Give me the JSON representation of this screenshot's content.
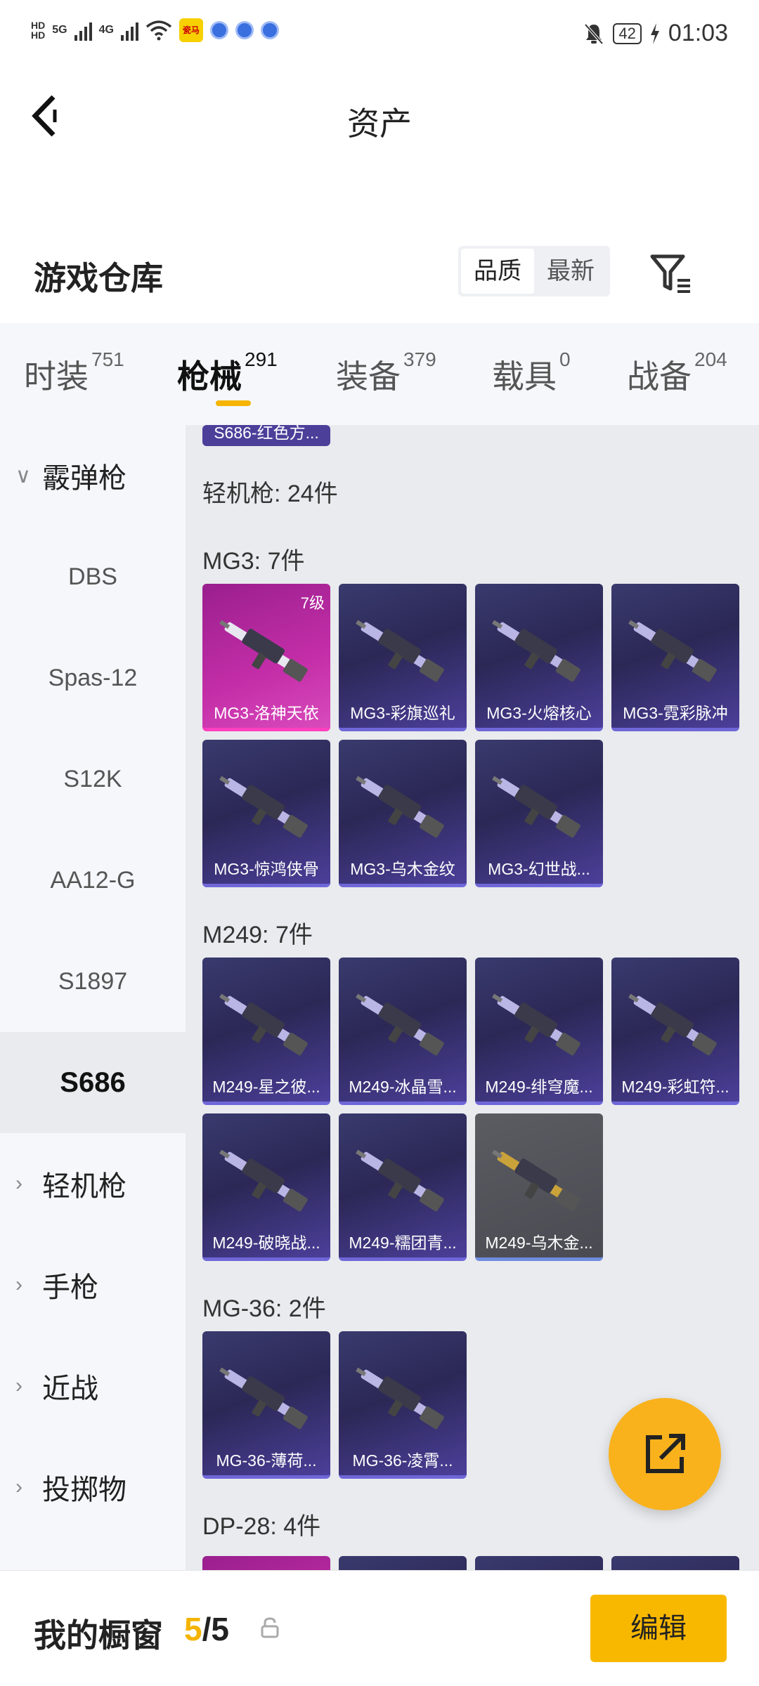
{
  "status_bar": {
    "hd1": "HD",
    "hd2": "HD",
    "net1": "5G",
    "net2": "4G",
    "app_icon_text": "瓷马",
    "battery": "42",
    "time": "01:03",
    "icons": [
      "signal-icon",
      "wifi-icon",
      "mute-bell-icon",
      "charging-icon"
    ]
  },
  "header": {
    "title": "资产"
  },
  "section": {
    "title": "游戏仓库",
    "sort_options": [
      "品质",
      "最新"
    ],
    "active_sort": "品质"
  },
  "tabs": [
    {
      "label": "时装",
      "count": "751"
    },
    {
      "label": "枪械",
      "count": "291"
    },
    {
      "label": "装备",
      "count": "379"
    },
    {
      "label": "载具",
      "count": "0"
    },
    {
      "label": "战备",
      "count": "204"
    }
  ],
  "active_tab": "枪械",
  "sidebar": {
    "items": [
      {
        "label": "霰弹枪",
        "type": "group-expanded"
      },
      {
        "label": "DBS",
        "type": "item"
      },
      {
        "label": "Spas-12",
        "type": "item"
      },
      {
        "label": "S12K",
        "type": "item"
      },
      {
        "label": "AA12-G",
        "type": "item"
      },
      {
        "label": "S1897",
        "type": "item"
      },
      {
        "label": "S686",
        "type": "selected"
      },
      {
        "label": "轻机枪",
        "type": "group"
      },
      {
        "label": "手枪",
        "type": "group"
      },
      {
        "label": "近战",
        "type": "group"
      },
      {
        "label": "投掷物",
        "type": "group"
      }
    ]
  },
  "content": {
    "partial_top_card": "S686-红色方...",
    "category_total": "轻机枪: 24件",
    "groups": [
      {
        "label": "MG3: 7件",
        "cards": [
          {
            "name": "MG3-洛神天依",
            "level": "7级",
            "rarity": "pink"
          },
          {
            "name": "MG3-彩旗巡礼",
            "level": "",
            "rarity": "purple"
          },
          {
            "name": "MG3-火熔核心",
            "level": "",
            "rarity": "purple"
          },
          {
            "name": "MG3-霓彩脉冲",
            "level": "",
            "rarity": "purple"
          },
          {
            "name": "MG3-惊鸿侠骨",
            "level": "",
            "rarity": "purple"
          },
          {
            "name": "MG3-乌木金纹",
            "level": "",
            "rarity": "purple"
          },
          {
            "name": "MG3-幻世战...",
            "level": "",
            "rarity": "purple"
          }
        ]
      },
      {
        "label": "M249: 7件",
        "cards": [
          {
            "name": "M249-星之彼...",
            "level": "",
            "rarity": "purple"
          },
          {
            "name": "M249-冰晶雪...",
            "level": "",
            "rarity": "purple"
          },
          {
            "name": "M249-绯穹魔...",
            "level": "",
            "rarity": "purple"
          },
          {
            "name": "M249-彩虹符...",
            "level": "",
            "rarity": "purple"
          },
          {
            "name": "M249-破晓战...",
            "level": "",
            "rarity": "purple"
          },
          {
            "name": "M249-糯团青...",
            "level": "",
            "rarity": "purple"
          },
          {
            "name": "M249-乌木金...",
            "level": "",
            "rarity": "gray"
          }
        ]
      },
      {
        "label": "MG-36: 2件",
        "cards": [
          {
            "name": "MG-36-薄荷...",
            "level": "",
            "rarity": "purple"
          },
          {
            "name": "MG-36-凌霄...",
            "level": "",
            "rarity": "purple"
          }
        ]
      },
      {
        "label": "DP-28: 4件",
        "cards": []
      }
    ]
  },
  "fab": {
    "icon": "share-edit-icon"
  },
  "bottom_bar": {
    "label": "我的橱窗",
    "count_current": "5",
    "count_sep": "/",
    "count_total": "5",
    "edit_label": "编辑"
  },
  "colors": {
    "accent": "#f5b400",
    "card_purple": "#2b2856",
    "card_pink": "#c42ea8"
  }
}
